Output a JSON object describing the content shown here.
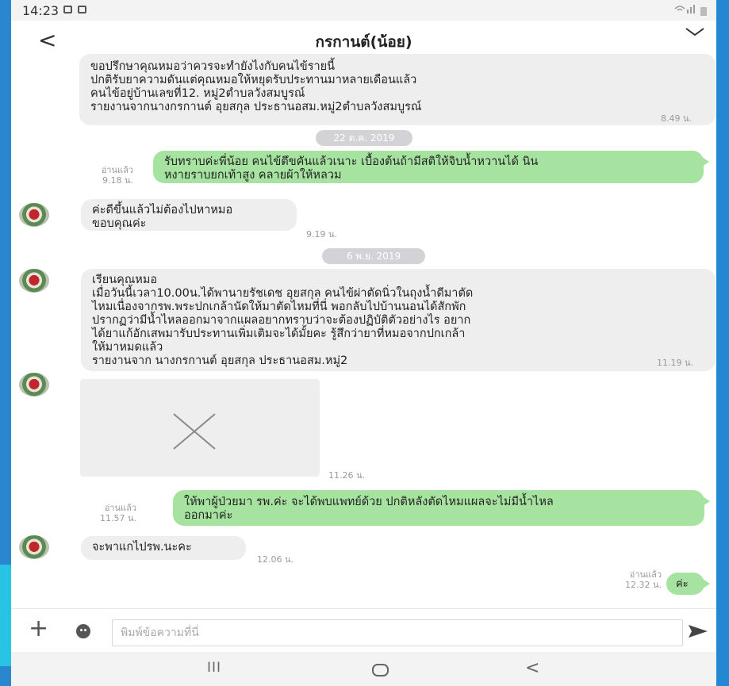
{
  "status": {
    "time": "14:23"
  },
  "header": {
    "title": "กรกานต์(น้อย)"
  },
  "messages": {
    "m1": {
      "text": "ขอปรึกษาคุณหมอว่าควรจะทำยังไงกับคนไข้รายนี้\nปกติรับยาความดันแต่คุณหมอให้หยุดรับประทานมาหลายเดือนแล้ว\nคนไข้อยู่บ้านเลขที่12. หมู่2ตำบลวังสมบูรณ์\nรายงานจากนางกรกานต์ อุยสกุล ประธานอสม.หมู่2ตำบลวังสมบูรณ์",
      "time": "8.49 น."
    },
    "date1": "22 ต.ค. 2019",
    "m2": {
      "text": "รับทราบค่ะพี่น้อย คนไข้ตึขคันแล้วเนาะ เบื้องต้นถ้ามีสติให้จิบน้ำหวานได้ นิน\nหงายราบยกเท้าสูง คลายผ้าให้หลวม",
      "read": "อ่านแล้ว",
      "time": "9.18 น."
    },
    "m3": {
      "text": "ค่ะดีขึ้นแล้วไม่ต้องไปหาหมอ\nขอบคุณค่ะ",
      "time": "9.19 น."
    },
    "date2": "6 พ.ย. 2019",
    "m4": {
      "text": "เรียนคุณหมอ\nเมื่อวันนี้เวลา10.00น.ได้พานายรัชเดช อุยสกุล คนไข้ผ่าตัดนิ่วในถุงน้ำดีมาตัด\nไหมเนื่องจากรพ.พระปกเกล้านัดให้มาตัดไหมที่นี่ พอกลับไปบ้านนอนได้สักพัก\nปรากฏว่ามีน้ำไหลออกมาจากแผลอยากทราบว่าจะต้องปฏิบัติตัวอย่างไร อยาก\nได้ยาแก้อักเสพมารับประทานเพิ่มเติมจะได้มั้ยคะ รู้สึกว่ายาที่หมอจากปกเกล้า\nให้มาหมดแล้ว\nรายงานจาก นางกรกานต์   อุยสกุล ประธานอสม.หมู่2",
      "time": "11.19 น."
    },
    "m5": {
      "time": "11.26 น."
    },
    "m6": {
      "text": "ให้พาผู้ป่วยมา รพ.ค่ะ จะได้พบแพทย์ด้วย ปกติหลังตัดไหมแผลจะไม่มีน้ำไหล\nออกมาค่ะ",
      "read": "อ่านแล้ว",
      "time": "11.57 น."
    },
    "m7": {
      "text": "จะพาแกไปรพ.นะคะ",
      "time": "12.06 น."
    },
    "m8": {
      "text": "ค่ะ",
      "read": "อ่านแล้ว",
      "time": "12.32 น."
    }
  },
  "input": {
    "placeholder": "พิมพ์ข้อความที่นี่"
  },
  "navbar": {
    "recent": "III",
    "back": "<"
  },
  "colors": {
    "outgoing_bubble": "#a6e3a0",
    "incoming_bubble": "#eeeeef",
    "date_pill": "#d3d3d7"
  }
}
